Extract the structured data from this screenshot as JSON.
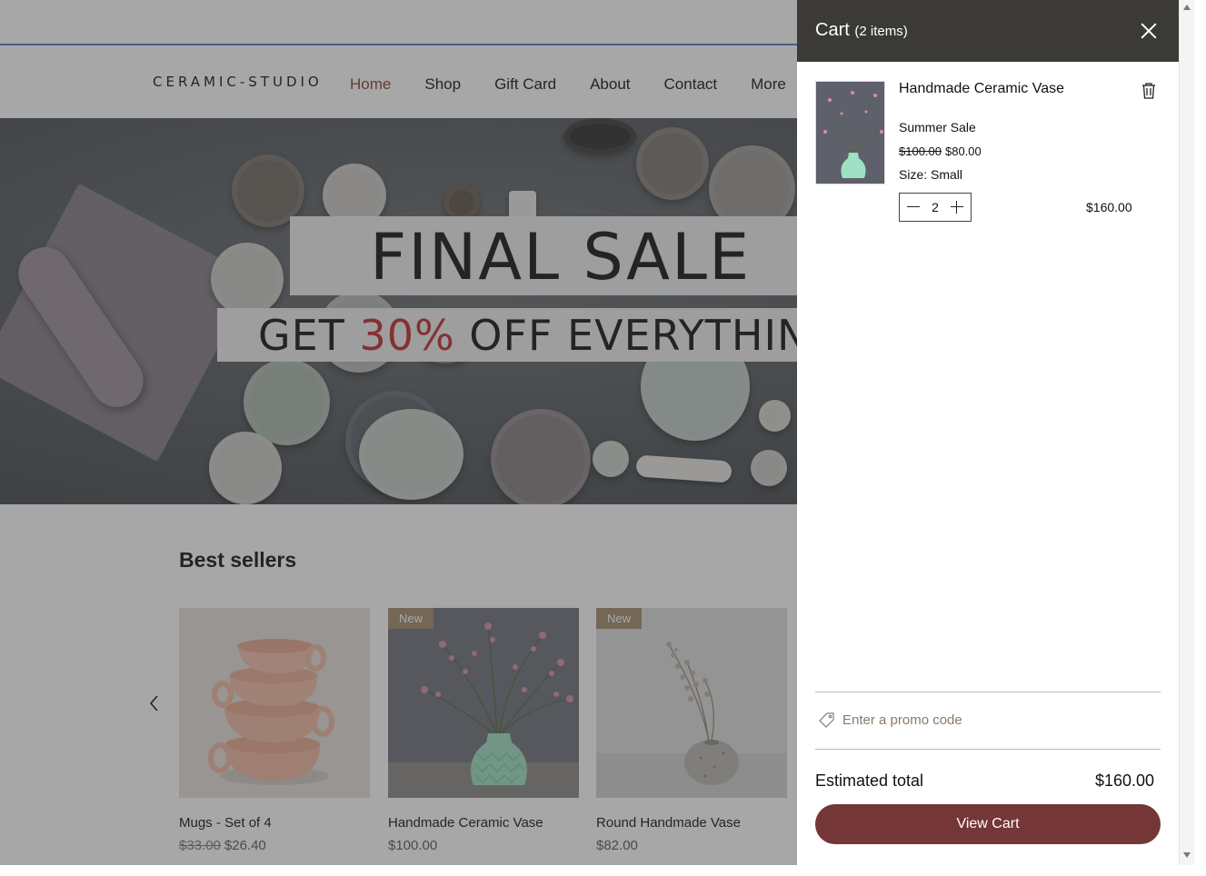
{
  "site": {
    "logo": "CERAMIC-STUDIO",
    "nav": [
      "Home",
      "Shop",
      "Gift Card",
      "About",
      "Contact",
      "More"
    ],
    "active_nav": "Home"
  },
  "hero": {
    "headline": "FINAL SALE",
    "subline_pre": "GET ",
    "subline_accent": "30%",
    "subline_post": " OFF EVERYTHING",
    "accent_color": "#c1272d"
  },
  "best_sellers": {
    "title": "Best sellers",
    "products": [
      {
        "name": "Mugs - Set of 4",
        "old_price": "$33.00",
        "price": "$26.40",
        "badge": ""
      },
      {
        "name": "Handmade Ceramic Vase",
        "old_price": "",
        "price": "$100.00",
        "badge": "New"
      },
      {
        "name": "Round Handmade Vase",
        "old_price": "",
        "price": "$82.00",
        "badge": "New"
      }
    ]
  },
  "cart": {
    "title": "Cart",
    "count_label": "(2 items)",
    "item": {
      "name": "Handmade Ceramic Vase",
      "option": "Summer Sale",
      "old_price": "$100.00",
      "price": "$80.00",
      "size_label": "Size: ",
      "size_value": "Small",
      "quantity": "2",
      "line_total": "$160.00"
    },
    "promo_placeholder": "Enter a promo code",
    "estimated_label": "Estimated total",
    "estimated_value": "$160.00",
    "view_cart_label": "View Cart",
    "accent_color": "#743636"
  }
}
